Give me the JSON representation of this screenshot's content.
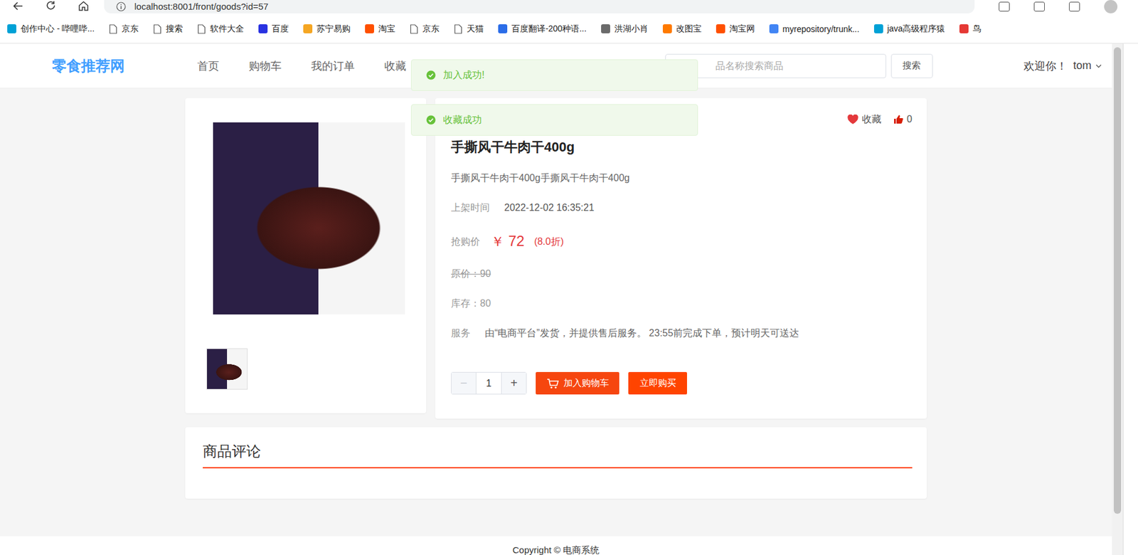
{
  "browser": {
    "url": "localhost:8001/front/goods?id=57",
    "bookmarks": [
      {
        "label": "创作中心 - 哔哩哔...",
        "kind": "site",
        "color": "#00a1d6"
      },
      {
        "label": "京东",
        "kind": "page",
        "color": "#555555"
      },
      {
        "label": "搜索",
        "kind": "page",
        "color": "#555555"
      },
      {
        "label": "软件大全",
        "kind": "page",
        "color": "#555555"
      },
      {
        "label": "百度",
        "kind": "site",
        "color": "#2932e1"
      },
      {
        "label": "苏宁易购",
        "kind": "site",
        "color": "#f5a623"
      },
      {
        "label": "淘宝",
        "kind": "site",
        "color": "#ff5000"
      },
      {
        "label": "京东",
        "kind": "page",
        "color": "#555555"
      },
      {
        "label": "天猫",
        "kind": "page",
        "color": "#555555"
      },
      {
        "label": "百度翻译-200种语...",
        "kind": "site",
        "color": "#2b6de8"
      },
      {
        "label": "洪湖小肖",
        "kind": "site",
        "color": "#6b6b6b"
      },
      {
        "label": "改图宝",
        "kind": "site",
        "color": "#ff7a00"
      },
      {
        "label": "淘宝网",
        "kind": "site",
        "color": "#ff5000"
      },
      {
        "label": "myrepository/trunk...",
        "kind": "site",
        "color": "#4285f4"
      },
      {
        "label": "java高级程序猿",
        "kind": "site",
        "color": "#00a1d6"
      },
      {
        "label": "鸟",
        "kind": "site",
        "color": "#e53935"
      }
    ]
  },
  "header": {
    "logo": "零食推荐网",
    "nav": [
      {
        "label": "首页",
        "selected": false
      },
      {
        "label": "购物车",
        "selected": false
      },
      {
        "label": "我的订单",
        "selected": false
      },
      {
        "label": "收藏",
        "selected": false
      }
    ],
    "search": {
      "placeholder": "品名称搜索商品",
      "button": "搜索"
    },
    "user": {
      "greeting": "欢迎你！",
      "name": "tom"
    }
  },
  "toasts": [
    "加入成功!",
    "收藏成功"
  ],
  "product": {
    "favorite": {
      "label": "收藏",
      "favorited": true
    },
    "likes": "0",
    "title": "手撕风干牛肉干400g",
    "description": "手撕风干牛肉干400g手撕风干牛肉干400g",
    "listed_label": "上架时间",
    "listed_value": "2022-12-02 16:35:21",
    "sale_label": "抢购价",
    "currency": "￥",
    "price": "72",
    "discount": "(8.0折)",
    "original_label": "原价：",
    "original_value": "90",
    "stock_label": "库存：",
    "stock_value": "80",
    "service_label": "服务",
    "service_value": "由“电商平台”发货，并提供售后服务。 23:55前完成下单，预计明天可送达",
    "quantity": {
      "minus": {
        "label": "−",
        "disabled": true
      },
      "value": "1",
      "plus": {
        "label": "+",
        "disabled": false
      }
    },
    "buttons": {
      "cart": "加入购物车",
      "buy": "立即购买"
    }
  },
  "comments": {
    "title": "商品评论"
  },
  "footer": "Copyright © 电商系统"
}
